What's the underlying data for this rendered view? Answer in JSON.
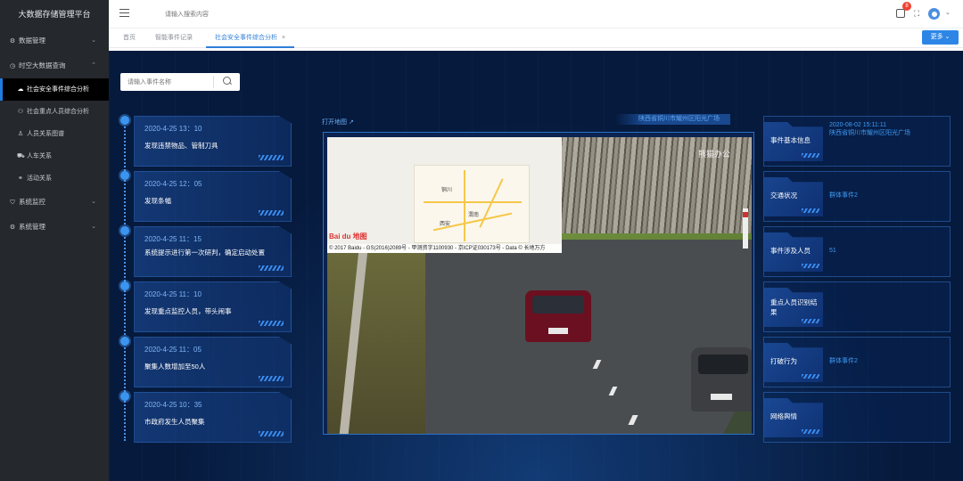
{
  "app": {
    "title": "大数据存储管理平台"
  },
  "sidebar": {
    "items": [
      {
        "label": "数据管理",
        "icon": "gear-icon"
      },
      {
        "label": "时空大数据查询",
        "icon": "clock-icon"
      },
      {
        "label": "系统监控",
        "icon": "shield-icon"
      },
      {
        "label": "系统管理",
        "icon": "gear-icon"
      }
    ],
    "subitems": [
      {
        "label": "社会安全事件综合分析",
        "icon": "cloud-icon"
      },
      {
        "label": "社会重点人员综合分析",
        "icon": "user-group-icon"
      },
      {
        "label": "人员关系图谱",
        "icon": "user-icon"
      },
      {
        "label": "人车关系",
        "icon": "car-icon"
      },
      {
        "label": "活动关系",
        "icon": "link-icon"
      }
    ]
  },
  "header": {
    "search_placeholder": "请输入搜索内容",
    "notification_count": "8"
  },
  "tabs": [
    {
      "label": "首页"
    },
    {
      "label": "智能事件记录"
    },
    {
      "label": "社会安全事件综合分析"
    }
  ],
  "more_label": "更多",
  "event_search": {
    "placeholder": "请输入事件名称"
  },
  "timeline": [
    {
      "time": "2020-4-25 13：10",
      "desc": "发现违禁物品、管制刀具"
    },
    {
      "time": "2020-4-25 12：05",
      "desc": "发现条幅"
    },
    {
      "time": "2020-4-25 11：15",
      "desc": "系统提示进行第一次研判，确定启动处置"
    },
    {
      "time": "2020-4-25 11：10",
      "desc": "发现重点监控人员，带头闹事"
    },
    {
      "time": "2020-4-25 11：05",
      "desc": "聚集人数增加至50人"
    },
    {
      "time": "2020-4-25 10：35",
      "desc": "市政府发生人员聚集"
    }
  ],
  "video": {
    "open_map_label": "打开地图",
    "location": "陕西省铜川市耀州区阳光广场",
    "watermark": "熊猫办公",
    "map_labels": {
      "city1": "铜川",
      "city2": "西安",
      "city3": "渭南"
    },
    "map_brand": "Bai du 地图",
    "map_copyright": "© 2017 Baidu - GS(2016)2089号 - 甲测资字1100930 - 京ICP证030173号 - Data © 长地万方"
  },
  "info": [
    {
      "title": "事件基本信息",
      "values": [
        "2020-08-02 15:11:11",
        "陕西省铜川市耀州区阳光广场"
      ]
    },
    {
      "title": "交通状况",
      "values": [
        "群体事件2"
      ]
    },
    {
      "title": "事件涉及人员",
      "values": [
        "51"
      ]
    },
    {
      "title": "重点人员识别结果",
      "values": []
    },
    {
      "title": "打破行为",
      "values": [
        "群体事件2"
      ]
    },
    {
      "title": "网络舆情",
      "values": []
    }
  ],
  "colors": {
    "accent": "#2f7fd8",
    "dark_bg": "#061a3d",
    "sidebar_bg": "#25282d"
  }
}
